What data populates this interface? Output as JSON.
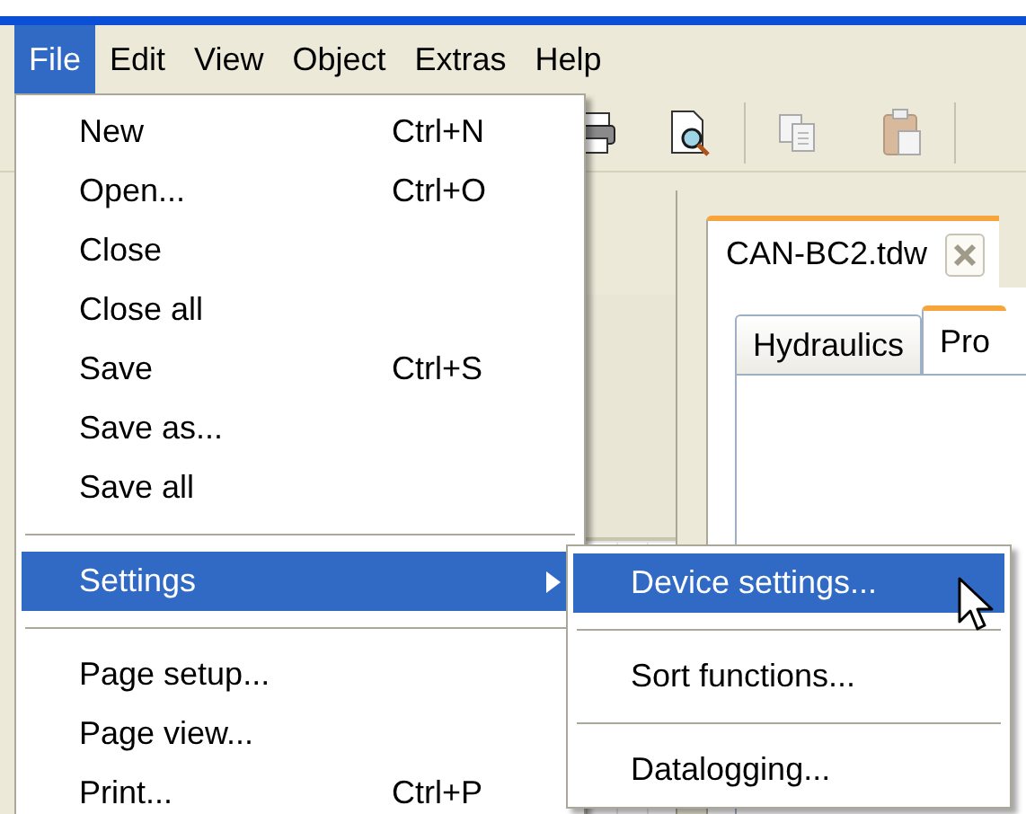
{
  "menubar": [
    {
      "label": "File",
      "selected": true
    },
    {
      "label": "Edit",
      "selected": false
    },
    {
      "label": "View",
      "selected": false
    },
    {
      "label": "Object",
      "selected": false
    },
    {
      "label": "Extras",
      "selected": false
    },
    {
      "label": "Help",
      "selected": false
    }
  ],
  "document_tab": {
    "title": "CAN-BC2.tdw"
  },
  "sheet_tabs": [
    {
      "label": "Hydraulics",
      "selected": false
    },
    {
      "label": "Pro",
      "selected": true
    }
  ],
  "file_menu": {
    "items": [
      {
        "kind": "item",
        "label": "New",
        "shortcut": "Ctrl+N",
        "selected": false
      },
      {
        "kind": "item",
        "label": "Open...",
        "shortcut": "Ctrl+O",
        "selected": false
      },
      {
        "kind": "item",
        "label": "Close",
        "selected": false
      },
      {
        "kind": "item",
        "label": "Close all",
        "selected": false
      },
      {
        "kind": "item",
        "label": "Save",
        "shortcut": "Ctrl+S",
        "selected": false
      },
      {
        "kind": "item",
        "label": "Save as...",
        "selected": false
      },
      {
        "kind": "item",
        "label": "Save all",
        "selected": false
      },
      {
        "kind": "separator"
      },
      {
        "kind": "submenu",
        "label": "Settings",
        "selected": true
      },
      {
        "kind": "separator"
      },
      {
        "kind": "item",
        "label": "Page setup...",
        "selected": false
      },
      {
        "kind": "item",
        "label": "Page view...",
        "selected": false
      },
      {
        "kind": "item",
        "label": "Print...",
        "shortcut": "Ctrl+P",
        "selected": false
      }
    ]
  },
  "settings_submenu": {
    "items": [
      {
        "kind": "item",
        "label": "Device settings...",
        "selected": true
      },
      {
        "kind": "separator"
      },
      {
        "kind": "item",
        "label": "Sort functions...",
        "selected": false
      },
      {
        "kind": "separator"
      },
      {
        "kind": "item",
        "label": "Datalogging...",
        "selected": false
      }
    ]
  }
}
